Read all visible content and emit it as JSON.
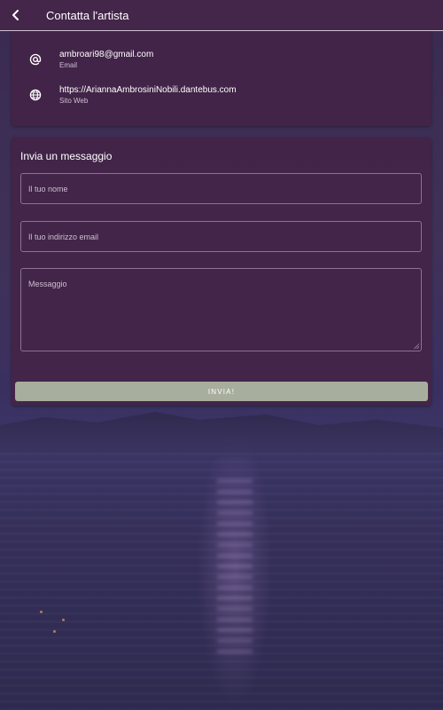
{
  "appbar": {
    "title": "Contatta l'artista",
    "back_icon": "chevron-left-icon"
  },
  "contact": {
    "items": [
      {
        "icon": "at-sign-icon",
        "value": "ambroari98@gmail.com",
        "label": "Email"
      },
      {
        "icon": "globe-icon",
        "value": "https://AriannaAmbrosiniNobili.dantebus.com",
        "label": "Sito Web"
      }
    ]
  },
  "form": {
    "title": "Invia un messaggio",
    "name_placeholder": "Il tuo nome",
    "email_placeholder": "Il tuo indirizzo email",
    "message_placeholder": "Messaggio",
    "submit_label": "INVIA!"
  },
  "colors": {
    "appbar_bg": "#43264a",
    "card_bg": "#432448",
    "submit_bg": "#a7ae9d",
    "field_border": "#8b7391"
  }
}
